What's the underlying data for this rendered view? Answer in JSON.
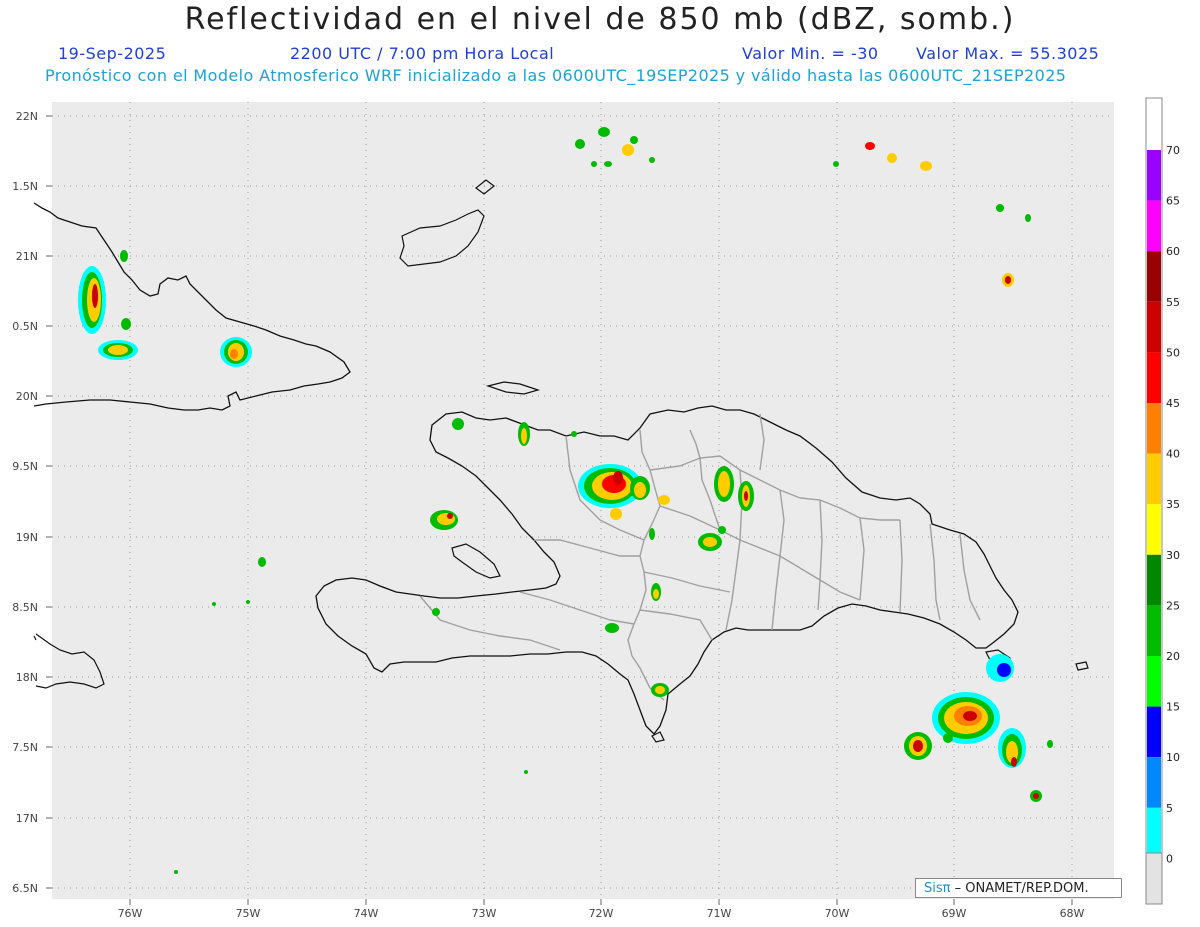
{
  "header": {
    "title": "Reflectividad en el nivel de 850 mb (dBZ, somb.)",
    "date": "19-Sep-2025",
    "time": "2200 UTC / 7:00 pm Hora Local",
    "min": "Valor Min. = -30",
    "max": "Valor Max. = 55.3025",
    "forecast": "Pronóstico con el Modelo Atmosferico WRF inicializado a las 0600UTC_19SEP2025 y válido hasta las  0600UTC_21SEP2025"
  },
  "axes": {
    "lat_labels": [
      "22N",
      "1.5N",
      "21N",
      "0.5N",
      "20N",
      "9.5N",
      "19N",
      "8.5N",
      "18N",
      "7.5N",
      "17N",
      "6.5N"
    ],
    "lon_labels": [
      "76W",
      "75W",
      "74W",
      "73W",
      "72W",
      "71W",
      "70W",
      "69W",
      "68W"
    ]
  },
  "colorbar": {
    "labels": [
      "70",
      "65",
      "60",
      "55",
      "50",
      "45",
      "40",
      "35",
      "30",
      "25",
      "20",
      "15",
      "10",
      "5",
      "0"
    ],
    "colors": [
      "#9900ff",
      "#ff00ff",
      "#990000",
      "#cc0000",
      "#ff0000",
      "#ff7f00",
      "#ffcc00",
      "#ffff00",
      "#008800",
      "#00bb00",
      "#00ff00",
      "#0000ff",
      "#0088ff",
      "#00ffff",
      "#ffffff"
    ]
  },
  "footer": {
    "logo": "Sisπ",
    "text": " – ONAMET/REP.DOM."
  },
  "colors": {
    "map_bg": "#ebebeb",
    "coast": "#111111",
    "border": "#a0a0a0"
  }
}
